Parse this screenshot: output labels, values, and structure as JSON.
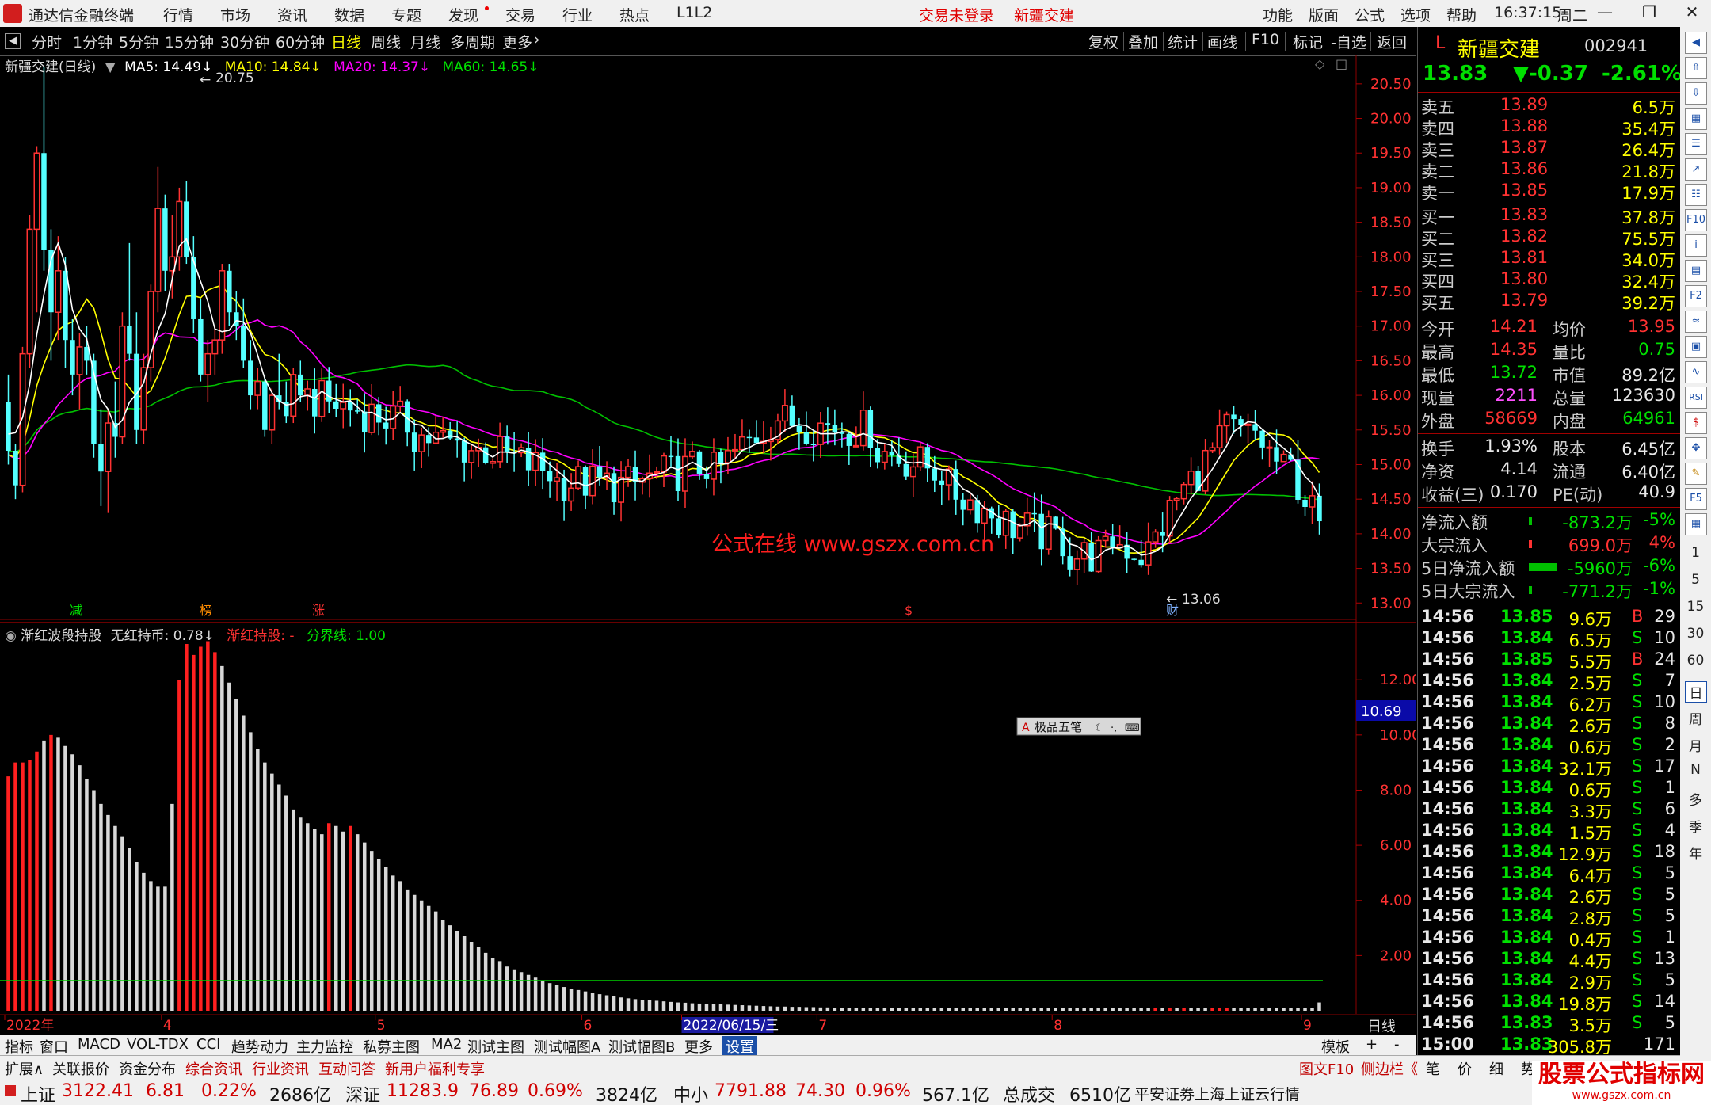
{
  "titlebar": {
    "app_name": "通达信金融终端",
    "menus": [
      "行情",
      "市场",
      "资讯",
      "数据",
      "专题",
      "发现",
      "交易",
      "行业",
      "热点",
      "L1L2"
    ],
    "login_status": "交易未登录",
    "stock_name": "新疆交建",
    "right_menus": [
      "功能",
      "版面",
      "公式",
      "选项",
      "帮助"
    ],
    "time": "16:37:15",
    "weekday": "周二"
  },
  "periods": {
    "items": [
      "分时",
      "1分钟",
      "5分钟",
      "15分钟",
      "30分钟",
      "60分钟",
      "日线",
      "周线",
      "月线",
      "多周期",
      "更多"
    ],
    "active": "日线",
    "right_items": [
      "复权",
      "叠加",
      "统计",
      "画线",
      "F10",
      "标记",
      "-自选",
      "返回"
    ]
  },
  "main_chart": {
    "header_name": "新疆交建(日线)",
    "ma5": "MA5: 14.49",
    "ma10": "MA10: 14.84",
    "ma20": "MA20: 14.37",
    "ma60": "MA60: 14.65",
    "high_label": "20.75",
    "low_label": "13.06",
    "watermark": "公式在线 www.gszx.com.cn",
    "markers": [
      "减",
      "榜",
      "涨",
      "$",
      "财"
    ],
    "colors": {
      "up": "#ff3232",
      "down": "#54ffff",
      "ma5": "#ffffff",
      "ma10": "#ffff00",
      "ma20": "#ff00ff",
      "ma60": "#00c000"
    }
  },
  "chart_data": [
    {
      "type": "candlestick",
      "title": "新疆交建(日线)",
      "ylim": [
        12.9,
        20.75
      ],
      "yticks": [
        13.0,
        13.5,
        14.0,
        14.5,
        15.0,
        15.5,
        16.0,
        16.5,
        17.0,
        17.5,
        18.0,
        18.5,
        19.0,
        19.5,
        20.0,
        20.5
      ],
      "x_labels": [
        {
          "text": "2022年",
          "index": 0
        },
        {
          "text": "4",
          "index": 22
        },
        {
          "text": "5",
          "index": 52
        },
        {
          "text": "6",
          "index": 81
        },
        {
          "text": "2022/06/15/三",
          "index": 95
        },
        {
          "text": "7",
          "index": 114
        },
        {
          "text": "8",
          "index": 147
        },
        {
          "text": "9",
          "index": 182
        }
      ],
      "ohlc": [
        [
          15.2,
          15.9,
          14.7,
          15.8
        ],
        [
          15.8,
          16.2,
          15.3,
          15.6
        ],
        [
          15.6,
          15.8,
          15.0,
          15.1
        ],
        [
          15.1,
          15.7,
          14.9,
          15.5
        ],
        [
          15.5,
          16.1,
          15.3,
          15.9
        ],
        [
          15.9,
          16.4,
          15.7,
          16.2
        ],
        [
          16.2,
          16.4,
          15.7,
          15.8
        ],
        [
          15.8,
          15.9,
          15.0,
          15.2
        ],
        [
          15.2,
          15.4,
          14.8,
          15.3
        ],
        [
          15.3,
          15.6,
          14.8,
          14.9
        ],
        [
          14.9,
          15.2,
          14.3,
          14.5
        ],
        [
          14.5,
          14.9,
          14.2,
          14.7
        ],
        [
          14.7,
          14.8,
          14.0,
          14.3
        ],
        [
          14.3,
          14.8,
          14.0,
          14.6
        ],
        [
          14.6,
          15.3,
          14.4,
          15.1
        ],
        [
          15.1,
          15.5,
          14.7,
          14.9
        ],
        [
          14.9,
          15.0,
          14.2,
          14.4
        ],
        [
          14.4,
          14.9,
          14.3,
          14.8
        ],
        [
          14.8,
          15.2,
          14.5,
          15.0
        ],
        [
          15.0,
          15.1,
          14.5,
          14.6
        ],
        [
          14.6,
          15.6,
          14.5,
          15.5
        ],
        [
          15.5,
          16.2,
          15.3,
          16.0
        ],
        [
          16.0,
          16.5,
          15.5,
          15.9
        ],
        [
          15.9,
          16.3,
          15.0,
          15.2
        ],
        [
          15.2,
          15.3,
          14.5,
          14.7
        ],
        [
          14.7,
          16.7,
          14.6,
          16.6
        ],
        [
          16.6,
          18.6,
          16.4,
          18.4
        ],
        [
          18.4,
          19.6,
          17.2,
          19.5
        ],
        [
          19.5,
          20.75,
          17.8,
          18.1
        ],
        [
          18.1,
          18.4,
          16.5,
          17.2
        ],
        [
          17.2,
          18.3,
          16.8,
          17.8
        ],
        [
          17.8,
          18.0,
          16.4,
          16.8
        ],
        [
          16.8,
          17.1,
          16.0,
          16.3
        ],
        [
          16.3,
          16.9,
          15.8,
          16.7
        ],
        [
          16.7,
          17.0,
          16.3,
          16.5
        ],
        [
          16.5,
          16.6,
          15.1,
          15.3
        ],
        [
          15.3,
          15.8,
          14.4,
          14.9
        ],
        [
          14.9,
          15.8,
          14.3,
          15.6
        ],
        [
          15.6,
          16.2,
          15.1,
          15.4
        ],
        [
          15.4,
          17.2,
          15.3,
          17.0
        ],
        [
          17.0,
          18.2,
          16.5,
          16.6
        ],
        [
          16.6,
          17.2,
          15.3,
          15.5
        ],
        [
          15.5,
          16.6,
          15.3,
          16.4
        ],
        [
          16.4,
          17.6,
          16.2,
          17.5
        ],
        [
          17.5,
          19.3,
          17.2,
          18.7
        ],
        [
          18.7,
          18.9,
          17.5,
          17.8
        ],
        [
          17.8,
          18.6,
          17.4,
          18.0
        ],
        [
          18.0,
          19.0,
          17.8,
          18.8
        ],
        [
          18.8,
          19.1,
          17.9,
          18.0
        ],
        [
          18.0,
          18.3,
          16.9,
          17.1
        ],
        [
          17.1,
          17.4,
          16.2,
          16.3
        ],
        [
          16.3,
          16.8,
          15.9,
          16.6
        ],
        [
          16.6,
          17.0,
          16.3,
          16.8
        ],
        [
          16.8,
          17.9,
          16.6,
          17.8
        ],
        [
          17.8,
          17.9,
          17.0,
          17.2
        ],
        [
          17.2,
          17.5,
          16.8,
          17.0
        ],
        [
          17.0,
          17.4,
          16.4,
          16.5
        ],
        [
          16.5,
          16.8,
          15.8,
          16.0
        ],
        [
          16.0,
          16.4,
          15.8,
          16.2
        ],
        [
          16.2,
          16.3,
          15.4,
          15.5
        ],
        [
          15.5,
          16.1,
          15.3,
          16.0
        ],
        [
          16.0,
          16.6,
          15.8,
          15.9
        ],
        [
          15.9,
          16.2,
          15.6,
          15.7
        ],
        [
          15.7,
          16.4,
          15.6,
          16.3
        ],
        [
          16.3,
          16.5,
          15.9,
          16.0
        ]
      ]
    },
    {
      "type": "bar",
      "title": "渐红波段持股",
      "series": [
        {
          "name": "无红持币",
          "value_label": "0.78"
        },
        {
          "name": "渐红持股",
          "value_label": "-"
        },
        {
          "name": "分界线",
          "value_label": "1.00",
          "constant": 1.0
        }
      ],
      "ylim": [
        0,
        13.5
      ],
      "yticks": [
        2.0,
        4.0,
        6.0,
        8.0,
        10.0,
        12.0
      ],
      "current_value": "10.69",
      "values": [
        8.5,
        9.0,
        9.0,
        9.1,
        9.4,
        9.8,
        10.0,
        9.9,
        9.6,
        9.3,
        8.9,
        8.4,
        8.0,
        7.5,
        7.1,
        6.7,
        6.3,
        5.9,
        5.4,
        5.0,
        4.7,
        4.5,
        4.5,
        7.5,
        12.0,
        13.3,
        12.9,
        13.2,
        13.4,
        13.0,
        12.5,
        11.9,
        11.3,
        10.7,
        10.1,
        9.5,
        9.0,
        8.6,
        8.2,
        7.8,
        7.3,
        7.0,
        6.8,
        6.6,
        6.4,
        6.8,
        6.7,
        6.5,
        6.7,
        6.4,
        6.1,
        5.8,
        5.5,
        5.2,
        4.9,
        4.7,
        4.4,
        4.2,
        4.0,
        3.8,
        3.6,
        3.3,
        3.1,
        2.9,
        2.7,
        2.5,
        2.3,
        2.1,
        1.9,
        1.8,
        1.6,
        1.5,
        1.4,
        1.3,
        1.2,
        1.1,
        1.0,
        0.92,
        0.86,
        0.8,
        0.75,
        0.7,
        0.65,
        0.6,
        0.56,
        0.52,
        0.48,
        0.45,
        0.42,
        0.4,
        0.38,
        0.36,
        0.34,
        0.32,
        0.3,
        0.29,
        0.27,
        0.26,
        0.25,
        0.24,
        0.23,
        0.22,
        0.21,
        0.2,
        0.19,
        0.18,
        0.17,
        0.16,
        0.15,
        0.15,
        0.14,
        0.14,
        0.13,
        0.13,
        0.12,
        0.12,
        0.11,
        0.11,
        0.1,
        0.1,
        0.1,
        0.1,
        0.1,
        0.1,
        0.1,
        0.1,
        0.1,
        0.1,
        0.1,
        0.1,
        0.1,
        0.1,
        0.1,
        0.1,
        0.1,
        0.1,
        0.1,
        0.1,
        0.1,
        0.1,
        0.1,
        0.1,
        0.1,
        0.1,
        0.1,
        0.1,
        0.1,
        0.1,
        0.1,
        0.1,
        0.1,
        0.1,
        0.1,
        0.1,
        0.1,
        0.1,
        0.1,
        0.1,
        0.1,
        0.1,
        0.1,
        0.1,
        0.1,
        0.1,
        0.1,
        0.1,
        0.1,
        0.1,
        0.1,
        0.1,
        0.1,
        0.1,
        0.1,
        0.1,
        0.1,
        0.1,
        0.1,
        0.1,
        0.1,
        0.1,
        0.1,
        0.1,
        0.1,
        0.1,
        0.3,
        0.5,
        0.7,
        0.9,
        1.0,
        1.1,
        1.1,
        1.1,
        1.0,
        0.95,
        0.9,
        0.85,
        0.8,
        0.78,
        0.78,
        0.78,
        0.78,
        0.78,
        0.78,
        0.78,
        0.78,
        0.78,
        0.78,
        0.78,
        0.78,
        0.78,
        0.78,
        0.78,
        0.78,
        0.78,
        0.78,
        0.78,
        0.78,
        0.78,
        0.78,
        0.78,
        0.78,
        0.78,
        0.78,
        0.78,
        0.78
      ]
    }
  ],
  "indicator": {
    "name": "渐红波段持股",
    "s1": "无红持币: 0.78",
    "s2": "渐红持股: -",
    "s3": "分界线: 1.00",
    "current": "10.69",
    "ime": "极品五笔"
  },
  "quote": {
    "code_prefix": "L",
    "name": "新疆交建",
    "code": "002941",
    "price": "13.83",
    "change": "▼-0.37",
    "pct": "-2.61%",
    "asks": [
      {
        "label": "卖五",
        "price": "13.89",
        "vol": "6.5万"
      },
      {
        "label": "卖四",
        "price": "13.88",
        "vol": "35.4万"
      },
      {
        "label": "卖三",
        "price": "13.87",
        "vol": "26.4万"
      },
      {
        "label": "卖二",
        "price": "13.86",
        "vol": "21.8万"
      },
      {
        "label": "卖一",
        "price": "13.85",
        "vol": "17.9万"
      }
    ],
    "bids": [
      {
        "label": "买一",
        "price": "13.83",
        "vol": "37.8万"
      },
      {
        "label": "买二",
        "price": "13.82",
        "vol": "75.5万"
      },
      {
        "label": "买三",
        "price": "13.81",
        "vol": "34.0万"
      },
      {
        "label": "买四",
        "price": "13.80",
        "vol": "32.4万"
      },
      {
        "label": "买五",
        "price": "13.79",
        "vol": "39.2万"
      }
    ],
    "stats1": [
      {
        "l1": "今开",
        "v1": "14.21",
        "l2": "均价",
        "v2": "13.95"
      },
      {
        "l1": "最高",
        "v1": "14.35",
        "l2": "量比",
        "v2": "0.75"
      },
      {
        "l1": "最低",
        "v1": "13.72",
        "l2": "市值",
        "v2": "89.2亿"
      },
      {
        "l1": "现量",
        "v1": "2211",
        "l2": "总量",
        "v2": "123630"
      },
      {
        "l1": "外盘",
        "v1": "58669",
        "l2": "内盘",
        "v2": "64961"
      }
    ],
    "stats2": [
      {
        "l1": "换手",
        "v1": "1.93%",
        "l2": "股本",
        "v2": "6.45亿"
      },
      {
        "l1": "净资",
        "v1": "4.14",
        "l2": "流通",
        "v2": "6.40亿"
      },
      {
        "l1": "收益(三)",
        "v1": "0.170",
        "l2": "PE(动)",
        "v2": "40.9"
      }
    ],
    "flows": [
      {
        "label": "净流入额",
        "value": "-873.2万",
        "pct": "-5%"
      },
      {
        "label": "大宗流入",
        "value": "699.0万",
        "pct": "4%"
      },
      {
        "label": "5日净流入额",
        "value": "-5960万",
        "pct": "-6%"
      },
      {
        "label": "5日大宗流入",
        "value": "-771.2万",
        "pct": "-1%"
      }
    ],
    "ticks": [
      {
        "t": "14:56",
        "p": "13.85",
        "v": "9.6万",
        "bs": "B",
        "n": "29"
      },
      {
        "t": "14:56",
        "p": "13.84",
        "v": "6.5万",
        "bs": "S",
        "n": "10"
      },
      {
        "t": "14:56",
        "p": "13.85",
        "v": "5.5万",
        "bs": "B",
        "n": "24"
      },
      {
        "t": "14:56",
        "p": "13.84",
        "v": "2.5万",
        "bs": "S",
        "n": "7"
      },
      {
        "t": "14:56",
        "p": "13.84",
        "v": "6.2万",
        "bs": "S",
        "n": "10"
      },
      {
        "t": "14:56",
        "p": "13.84",
        "v": "2.6万",
        "bs": "S",
        "n": "8"
      },
      {
        "t": "14:56",
        "p": "13.84",
        "v": "0.6万",
        "bs": "S",
        "n": "2"
      },
      {
        "t": "14:56",
        "p": "13.84",
        "v": "32.1万",
        "bs": "S",
        "n": "17"
      },
      {
        "t": "14:56",
        "p": "13.84",
        "v": "0.6万",
        "bs": "S",
        "n": "1"
      },
      {
        "t": "14:56",
        "p": "13.84",
        "v": "3.3万",
        "bs": "S",
        "n": "6"
      },
      {
        "t": "14:56",
        "p": "13.84",
        "v": "1.5万",
        "bs": "S",
        "n": "4"
      },
      {
        "t": "14:56",
        "p": "13.84",
        "v": "12.9万",
        "bs": "S",
        "n": "18"
      },
      {
        "t": "14:56",
        "p": "13.84",
        "v": "6.4万",
        "bs": "S",
        "n": "5"
      },
      {
        "t": "14:56",
        "p": "13.84",
        "v": "2.6万",
        "bs": "S",
        "n": "5"
      },
      {
        "t": "14:56",
        "p": "13.84",
        "v": "2.8万",
        "bs": "S",
        "n": "5"
      },
      {
        "t": "14:56",
        "p": "13.84",
        "v": "0.4万",
        "bs": "S",
        "n": "1"
      },
      {
        "t": "14:56",
        "p": "13.84",
        "v": "4.4万",
        "bs": "S",
        "n": "13"
      },
      {
        "t": "14:56",
        "p": "13.84",
        "v": "2.9万",
        "bs": "S",
        "n": "5"
      },
      {
        "t": "14:56",
        "p": "13.84",
        "v": "19.8万",
        "bs": "S",
        "n": "14"
      },
      {
        "t": "14:56",
        "p": "13.83",
        "v": "3.5万",
        "bs": "S",
        "n": "5"
      },
      {
        "t": "15:00",
        "p": "13.83",
        "v": "305.8万",
        "bs": "",
        "n": "171"
      }
    ]
  },
  "right_toolbar": {
    "labels": [
      "1",
      "5",
      "15",
      "30",
      "60",
      "日",
      "周",
      "月",
      "N",
      "多",
      "季",
      "年"
    ]
  },
  "tabbar": {
    "items": [
      "指标",
      "窗口",
      "MACD",
      "VOL-TDX",
      "CCI",
      "趋势动力",
      "主力监控",
      "私募主图",
      "MA2",
      "测试主图",
      "测试幅图A",
      "测试幅图B",
      "更多",
      "设置"
    ],
    "right": [
      "模板",
      "+",
      "-"
    ],
    "period_label": "日线"
  },
  "extbar": {
    "items": [
      "扩展∧",
      "关联报价",
      "资金分布",
      "综合资讯",
      "行业资讯",
      "互动问答",
      "新用户福利专享"
    ],
    "right": [
      "图文F10",
      "侧边栏《",
      "笔",
      "价",
      "细",
      "势"
    ]
  },
  "statusbar": {
    "sh_label": "上证",
    "sh_val": "3122.41",
    "sh_chg": "6.81",
    "sh_pct": "0.22%",
    "sh_amt": "2686亿",
    "sz_label": "深证",
    "sz_val": "11283.9",
    "sz_chg": "76.89",
    "sz_pct": "0.69%",
    "sz_amt": "3824亿",
    "zx_label": "中小",
    "zx_val": "7791.88",
    "zx_chg": "74.30",
    "zx_pct": "0.96%",
    "zx_amt": "567.1亿",
    "total_label": "总成交",
    "total_amt": "6510亿",
    "server": "平安证券上海上证云行情",
    "logo": "股票公式指标网",
    "logo_url": "www.gszx.com.cn"
  }
}
